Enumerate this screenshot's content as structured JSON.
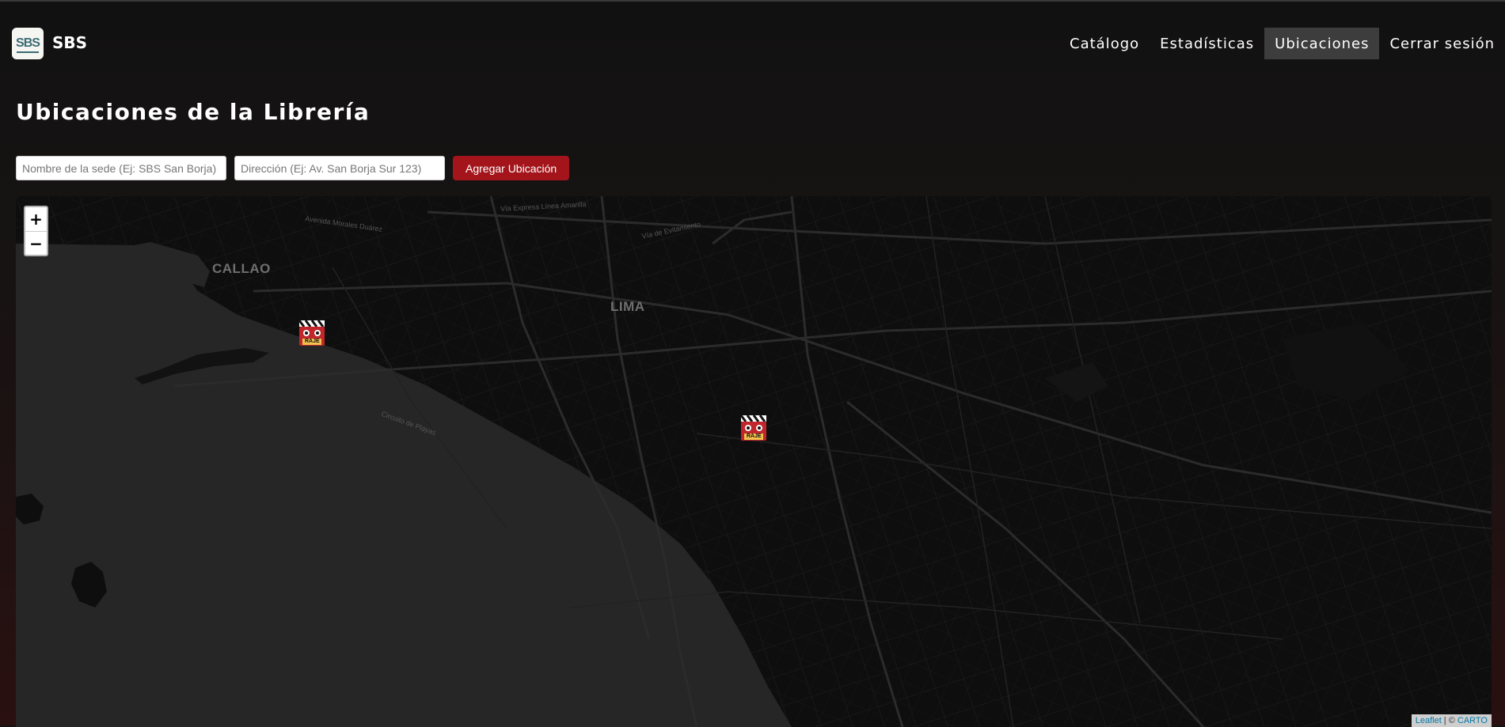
{
  "brand": {
    "logo_text": "SBS",
    "name": "SBS"
  },
  "nav": {
    "items": [
      {
        "label": "Catálogo"
      },
      {
        "label": "Estadísticas"
      },
      {
        "label": "Ubicaciones",
        "active": true
      },
      {
        "label": "Cerrar sesión"
      }
    ]
  },
  "page": {
    "title": "Ubicaciones de la Librería"
  },
  "form": {
    "name_placeholder": "Nombre de la sede (Ej: SBS San Borja)",
    "address_placeholder": "Dirección (Ej: Av. San Borja Sur 123)",
    "add_label": "Agregar Ubicación"
  },
  "map": {
    "zoom_in": "+",
    "zoom_out": "−",
    "labels": {
      "callao": "CALLAO",
      "lima": "LIMA"
    },
    "streets": [
      "Vía Expresa Línea Amarilla",
      "Avenida Morales Duárez",
      "Vía de Evitamiento",
      "Circuito de Playas"
    ],
    "markers": [
      {
        "icon": "raje-marker-icon",
        "text": "RAJE"
      },
      {
        "icon": "raje-marker-icon",
        "text": "RAJE"
      }
    ],
    "attribution": {
      "leaflet": "Leaflet",
      "sep": " | © ",
      "carto": "CARTO"
    }
  },
  "colors": {
    "accent": "#a3151b",
    "active_nav": "#3d3d3d",
    "sea": "#262626",
    "land": "#0e0e0e"
  }
}
